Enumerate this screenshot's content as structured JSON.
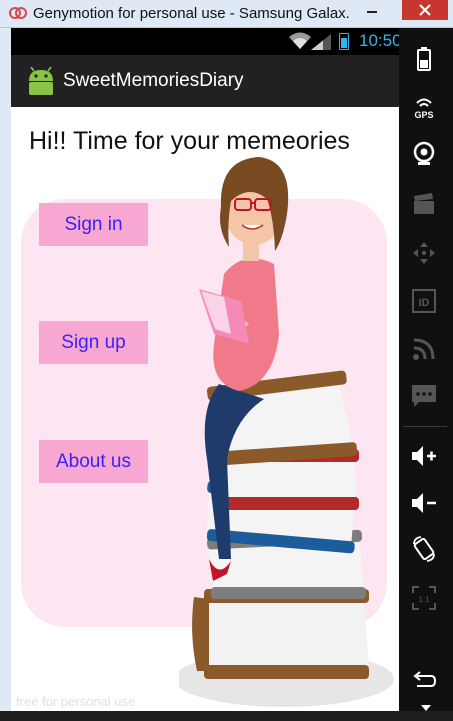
{
  "window": {
    "title": "Genymotion for personal use - Samsung Galax...",
    "watermark": "free for personal use"
  },
  "status_bar": {
    "time": "10:50"
  },
  "action_bar": {
    "app_title": "SweetMemoriesDiary"
  },
  "main": {
    "greeting": "Hi!! Time for your memeories",
    "buttons": {
      "sign_in": "Sign in",
      "sign_up": "Sign up",
      "about_us": "About us"
    }
  },
  "toolbar": {
    "gps_label": "GPS",
    "id_label": "ID",
    "ratio_label": "1:1"
  },
  "colors": {
    "button_bg": "#f8a7d2",
    "button_text": "#3b22f5",
    "panel_bg": "#fde6f2",
    "status_accent": "#33b5e5",
    "action_bar": "#212121"
  }
}
